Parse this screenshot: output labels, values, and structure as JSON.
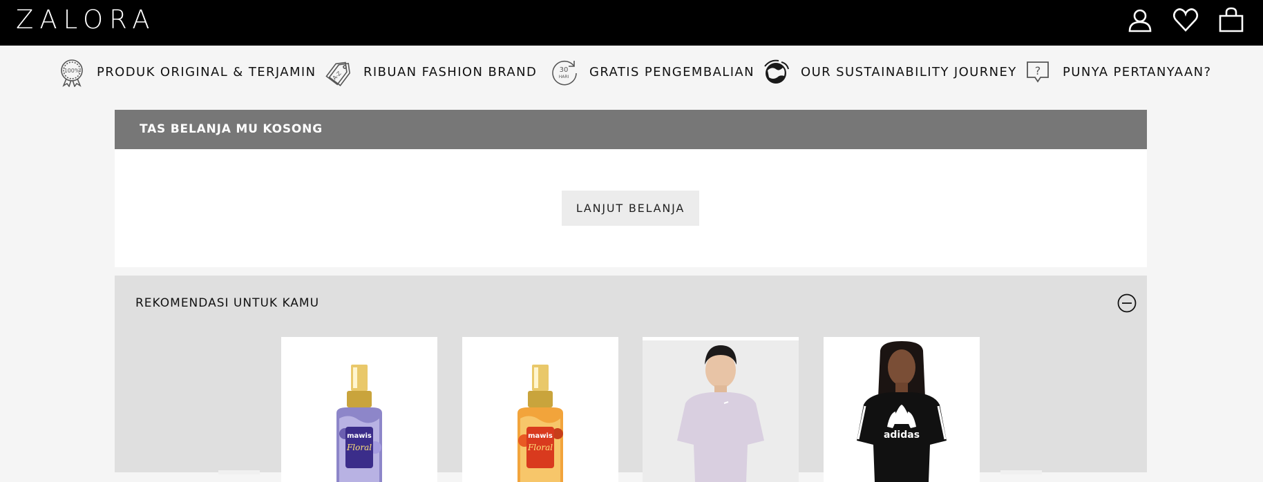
{
  "header": {
    "logo": "ZALORA",
    "icons": [
      "user-icon",
      "heart-icon",
      "bag-icon"
    ]
  },
  "usp": [
    {
      "label": "PRODUK ORIGINAL & TERJAMIN",
      "icon": "original-badge-icon",
      "badge": "100%"
    },
    {
      "label": "RIBUAN FASHION BRAND",
      "icon": "tags-icon",
      "badge": "A-Z"
    },
    {
      "label": "GRATIS PENGEMBALIAN",
      "icon": "return-30-days-icon",
      "badge": "30 HARI"
    },
    {
      "label": "OUR SUSTAINABILITY JOURNEY",
      "icon": "earth-icon"
    },
    {
      "label": "PUNYA PERTANYAAN?",
      "icon": "question-bubble-icon",
      "badge": "?"
    }
  ],
  "bag": {
    "title": "TAS BELANJA MU KOSONG",
    "continue_label": "LANJUT BELANJA"
  },
  "recommendations": {
    "title": "REKOMENDASI UNTUK KAMU",
    "collapse_icon": "minus-circle-icon",
    "products": [
      {
        "name": "mawis-floral-violet-mist",
        "brand_text": "mawis",
        "product_text": "Floral",
        "accent": "#6b5fb0"
      },
      {
        "name": "mawis-floral-summer-mist",
        "brand_text": "mawis",
        "product_text": "Floral",
        "accent": "#e85a24"
      },
      {
        "name": "lilac-tshirt",
        "accent": "#d9cfe0"
      },
      {
        "name": "adidas-black-tee",
        "brand_text": "adidas",
        "accent": "#111111"
      }
    ]
  },
  "colors": {
    "header_bg": "#000000",
    "bag_header_bg": "#777777",
    "reco_bg": "#dfdfdf",
    "button_bg": "#ececec"
  }
}
